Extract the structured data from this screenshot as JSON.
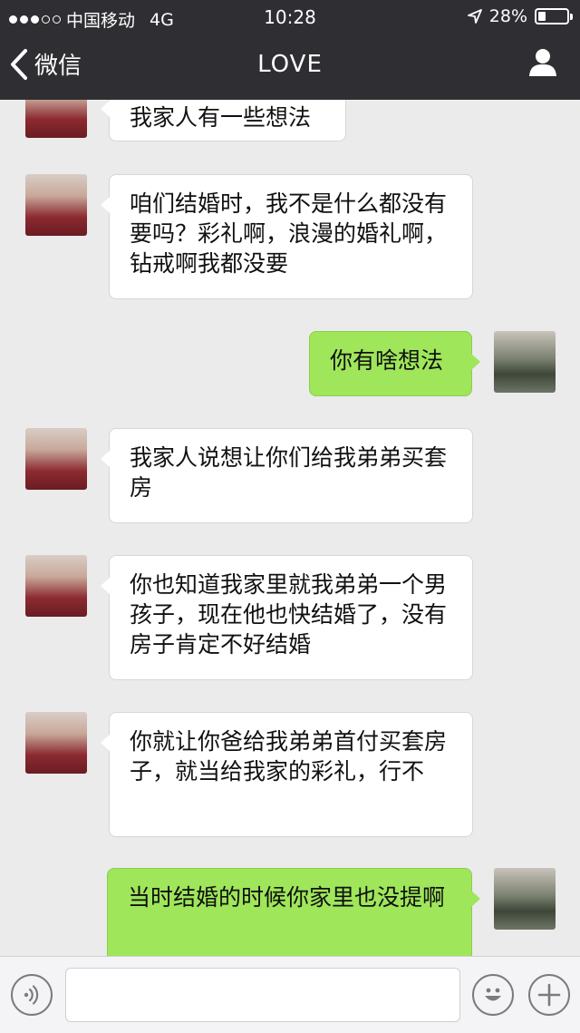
{
  "status_bar": {
    "carrier": "中国移动",
    "network": "4G",
    "time": "10:28",
    "battery_percent": "28%",
    "battery_level": 0.28
  },
  "nav": {
    "back_label": "微信",
    "title": "LOVE"
  },
  "messages": [
    {
      "side": "in",
      "text": "我家人有一些想法"
    },
    {
      "side": "in",
      "text": "咱们结婚时，我不是什么都没有要吗？彩礼啊，浪漫的婚礼啊，钻戒啊我都没要"
    },
    {
      "side": "out",
      "text": "你有啥想法"
    },
    {
      "side": "in",
      "text": "我家人说想让你们给我弟弟买套房"
    },
    {
      "side": "in",
      "text": "你也知道我家里就我弟弟一个男孩子，现在他也快结婚了，没有房子肯定不好结婚"
    },
    {
      "side": "in",
      "text": "你就让你爸给我弟弟首付买套房子，就当给我家的彩礼，行不"
    },
    {
      "side": "out",
      "text": "当时结婚的时候你家里也没提啊"
    }
  ],
  "input_bar": {
    "voice_icon": "voice-icon",
    "emoji_icon": "emoji-icon",
    "plus_icon": "plus-icon",
    "text_value": ""
  },
  "colors": {
    "bar_bg": "#2f2f33",
    "chat_bg": "#ebebeb",
    "out_bubble": "#9fe65a",
    "in_bubble": "#ffffff"
  }
}
